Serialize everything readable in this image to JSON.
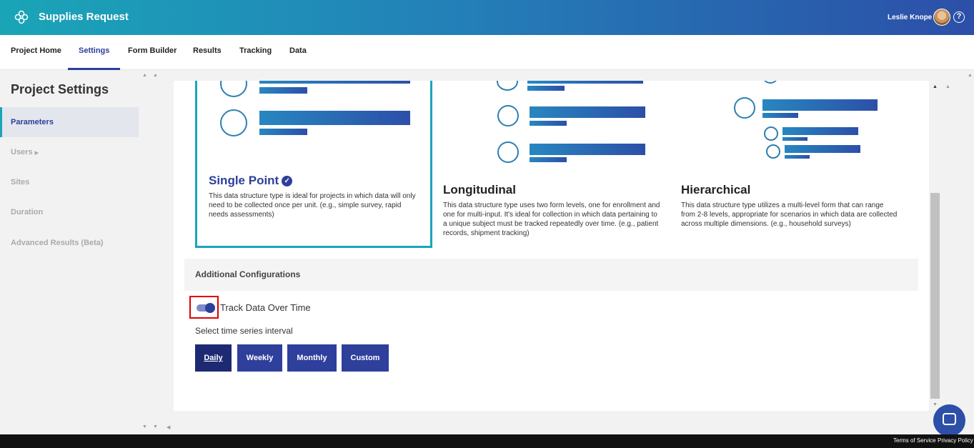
{
  "header": {
    "app_title": "Supplies Request",
    "user_name": "Leslie Knope",
    "help_icon": "?"
  },
  "nav": {
    "tabs": [
      {
        "label": "Project Home"
      },
      {
        "label": "Settings"
      },
      {
        "label": "Form Builder"
      },
      {
        "label": "Results"
      },
      {
        "label": "Tracking"
      },
      {
        "label": "Data"
      }
    ]
  },
  "sidebar": {
    "title": "Project Settings",
    "items": [
      {
        "label": "Parameters"
      },
      {
        "label": "Users"
      },
      {
        "label": "Sites"
      },
      {
        "label": "Duration"
      },
      {
        "label": "Advanced Results (Beta)"
      }
    ]
  },
  "options": {
    "single": {
      "title": "Single Point",
      "desc": "This data structure type is ideal for projects in which data will only need to be collected once per unit. (e.g., simple survey, rapid needs assessments)"
    },
    "longitudinal": {
      "title": "Longitudinal",
      "desc": "This data structure type uses two form levels, one for enrollment and one for multi-input. It's ideal for collection in which data pertaining to a unique subject must be tracked repeatedly over time. (e.g., patient records, shipment tracking)"
    },
    "hierarchical": {
      "title": "Hierarchical",
      "desc": "This data structure type utilizes a multi-level form that can range from 2-8 levels, appropriate for scenarios in which data are collected across multiple dimensions. (e.g., household surveys)"
    }
  },
  "config": {
    "title": "Additional Configurations",
    "toggle_label": "Track Data Over Time",
    "toggle_on": true,
    "interval_label": "Select time series interval",
    "intervals": [
      "Daily",
      "Weekly",
      "Monthly",
      "Custom"
    ],
    "selected_interval": "Daily"
  },
  "footer": {
    "terms": "Terms of Service",
    "privacy": "Privacy Policy"
  }
}
